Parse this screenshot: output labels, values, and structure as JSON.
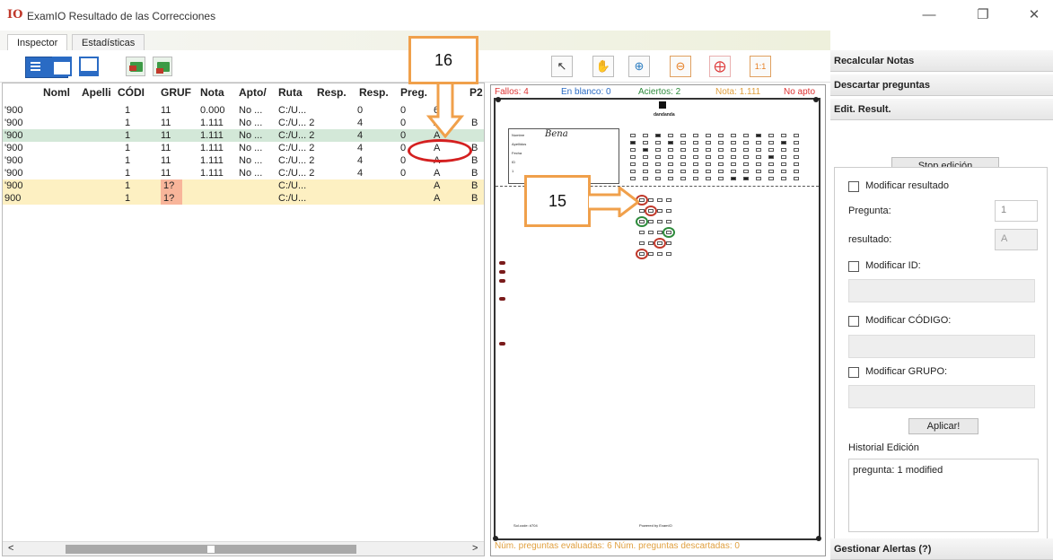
{
  "window": {
    "logo": "IO",
    "title": "ExamIO Resultado de las Correcciones",
    "minimize": "—",
    "maximize": "❐",
    "close": "✕"
  },
  "tabs": [
    {
      "label": "Inspector",
      "active": true
    },
    {
      "label": "Estadísticas",
      "active": false
    }
  ],
  "table": {
    "headers": [
      "Noml",
      "Apelli",
      "CÓDI",
      "GRUF",
      "Nota",
      "Apto/",
      "Ruta",
      "Resp.",
      "Resp.",
      "Preg.",
      "P2"
    ],
    "rows": [
      {
        "id": "'900",
        "cod": "1",
        "grupo": "11",
        "nota": "0.000",
        "apto": "No ...",
        "ruta": "C:/U...",
        "resp1": "0",
        "resp2": "0",
        "preg": "6",
        "p1": "",
        "p2": "",
        "style": "normal"
      },
      {
        "id": "'900",
        "cod": "1",
        "grupo": "11",
        "nota": "1.111",
        "apto": "No ...",
        "ruta": "C:/U... 2",
        "resp1": "4",
        "resp2": "0",
        "preg": "A",
        "p1": "B",
        "p2": "",
        "style": "normal"
      },
      {
        "id": "'900",
        "cod": "1",
        "grupo": "11",
        "nota": "1.111",
        "apto": "No ...",
        "ruta": "C:/U... 2",
        "resp1": "4",
        "resp2": "0",
        "preg": "A",
        "p1": "",
        "p2": "",
        "style": "green"
      },
      {
        "id": "'900",
        "cod": "1",
        "grupo": "11",
        "nota": "1.111",
        "apto": "No ...",
        "ruta": "C:/U... 2",
        "resp1": "4",
        "resp2": "0",
        "preg": "A",
        "p1": "B",
        "p2": "",
        "style": "normal"
      },
      {
        "id": "'900",
        "cod": "1",
        "grupo": "11",
        "nota": "1.111",
        "apto": "No ...",
        "ruta": "C:/U... 2",
        "resp1": "4",
        "resp2": "0",
        "preg": "A",
        "p1": "B",
        "p2": "",
        "style": "normal"
      },
      {
        "id": "'900",
        "cod": "1",
        "grupo": "11",
        "nota": "1.111",
        "apto": "No ...",
        "ruta": "C:/U... 2",
        "resp1": "4",
        "resp2": "0",
        "preg": "A",
        "p1": "B",
        "p2": "",
        "style": "normal"
      },
      {
        "id": "'900",
        "cod": "1",
        "grupo": "1?",
        "nota": "",
        "apto": "",
        "ruta": "C:/U...",
        "resp1": "",
        "resp2": "",
        "preg": "A",
        "p1": "B",
        "p2": "",
        "style": "yellow"
      },
      {
        "id": "900",
        "cod": "1",
        "grupo": "1?",
        "nota": "",
        "apto": "",
        "ruta": "C:/U...",
        "resp1": "",
        "resp2": "",
        "preg": "A",
        "p1": "B",
        "p2": "",
        "style": "yellow"
      }
    ],
    "scroll_left": "<",
    "scroll_right": ">"
  },
  "viewer": {
    "fallos": "Fallos: 4",
    "blanco": "En blanco: 0",
    "aciertos": "Aciertos: 2",
    "nota": "Nota: 1.111",
    "apto": "No apto",
    "footer": "Núm. preguntas evaluadas: 6  Núm. preguntas descartadas: 0",
    "sheet_header": "dandanda",
    "sheet_name": "Bena",
    "form_labels": [
      "Nombre",
      "Apellidos",
      "Fecha",
      "ID",
      "1"
    ],
    "sheet_footer_left": "Sol.code: #704",
    "sheet_footer_right": "Powered by ExamIO",
    "tools": [
      "cursor-icon",
      "hand-icon",
      "zoom-in-icon",
      "zoom-out-icon",
      "fit-icon",
      "actual-size-icon"
    ],
    "actual_size_label": "1:1"
  },
  "right_panel": {
    "recalcular": "Recalcular Notas",
    "descartar": "Descartar preguntas",
    "edit_result": "Edit. Result.",
    "stop_edicion": "Stop edición",
    "modificar_resultado": "Modificar resultado",
    "pregunta_label": "Pregunta:",
    "pregunta_value": "1",
    "resultado_label": "resultado:",
    "resultado_value": "A",
    "modificar_id": "Modificar ID:",
    "modificar_codigo": "Modificar CÓDIGO:",
    "modificar_grupo": "Modificar GRUPO:",
    "aplicar": "Aplicar!",
    "historial_label": "Historial Edición",
    "historial": "pregunta: 1  modified",
    "alertas": "Gestionar Alertas (?)"
  },
  "annotations": {
    "callout_16": "16",
    "callout_15": "15"
  },
  "colors": {
    "accent": "#2a6bc4",
    "callout": "#f0a04b",
    "highlight_oval": "#d42020",
    "row_selected": "#d3e8d8",
    "row_warning": "#fdf0c2",
    "cell_warning": "#f8b59a"
  }
}
